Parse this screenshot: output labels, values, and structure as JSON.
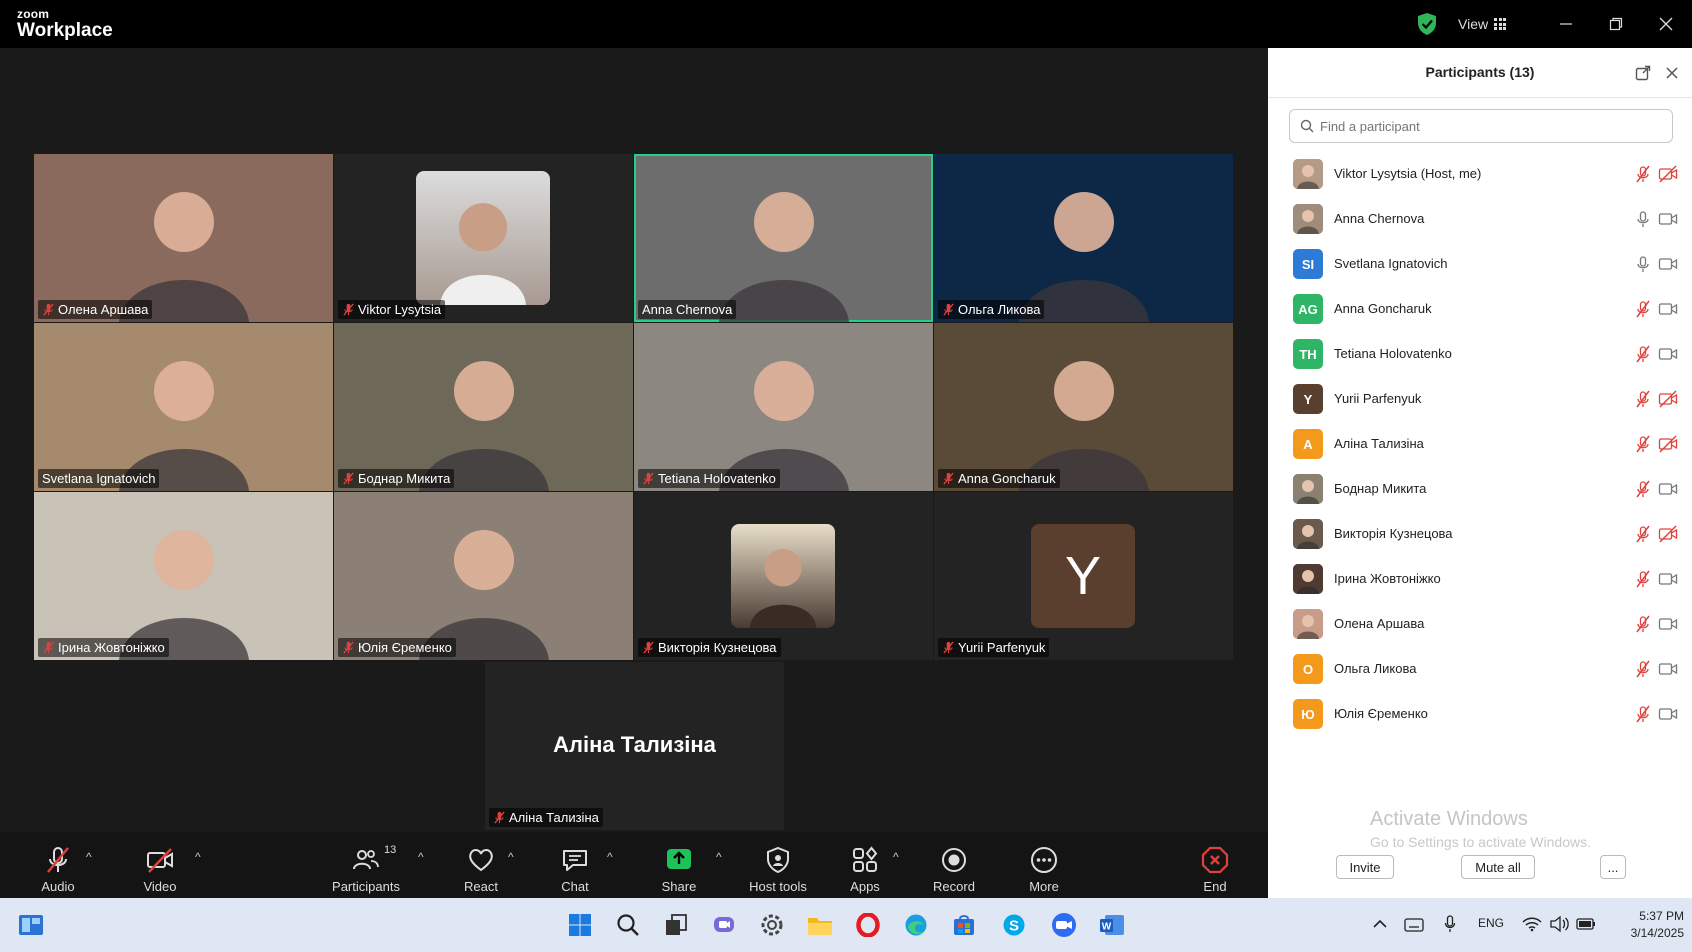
{
  "app": {
    "brand_small": "zoom",
    "brand_big": "Workplace",
    "view_label": "View"
  },
  "tiles": [
    {
      "name": "Олена Аршава",
      "muted": true,
      "bg": "#8a6a5c"
    },
    {
      "name": "Viktor Lysytsia",
      "muted": true,
      "bg": "#232323"
    },
    {
      "name": "Anna Chernova",
      "muted": false,
      "bg": "#6d6d6d",
      "active": true
    },
    {
      "name": "Ольга Ликова",
      "muted": true,
      "bg": "#0d2746"
    },
    {
      "name": "Svetlana Ignatovich",
      "muted": false,
      "bg": "#a58a6e"
    },
    {
      "name": "Боднар Микита",
      "muted": true,
      "bg": "#6e6858"
    },
    {
      "name": "Tetiana Holovatenko",
      "muted": true,
      "bg": "#8d8782"
    },
    {
      "name": "Anna Goncharuk",
      "muted": true,
      "bg": "#5a4a38"
    },
    {
      "name": "Ірина Жовтоніжко",
      "muted": true,
      "bg": "#c9c2b6"
    },
    {
      "name": "Юлія Єременко",
      "muted": true,
      "bg": "#8c8076"
    },
    {
      "name": "Викторія Кузнецова",
      "muted": true,
      "bg": "#232323"
    },
    {
      "name": "Yurii Parfenyuk",
      "muted": true,
      "bg": "#232323",
      "letter": "Y"
    }
  ],
  "spotlight_tile": {
    "display_name": "Аліна Тализіна",
    "label": "Аліна Тализіна"
  },
  "toolbar": {
    "audio": "Audio",
    "video": "Video",
    "participants": "Participants",
    "participants_count": "13",
    "react": "React",
    "chat": "Chat",
    "share": "Share",
    "host_tools": "Host tools",
    "apps": "Apps",
    "record": "Record",
    "more": "More",
    "end": "End"
  },
  "panel": {
    "title": "Participants (13)",
    "search_placeholder": "Find a participant",
    "participants": [
      {
        "name": "Viktor Lysytsia (Host, me)",
        "avatar": "photo",
        "color": "#b59a86",
        "mic": "muted",
        "cam": "off"
      },
      {
        "name": "Anna Chernova",
        "avatar": "photo",
        "color": "#a08c7a",
        "mic": "on",
        "cam": "on"
      },
      {
        "name": "Svetlana Ignatovich",
        "avatar": "SI",
        "color": "#2d7bd6",
        "mic": "on",
        "cam": "on"
      },
      {
        "name": "Anna Goncharuk",
        "avatar": "AG",
        "color": "#2fb566",
        "mic": "muted",
        "cam": "on"
      },
      {
        "name": "Tetiana Holovatenko",
        "avatar": "TH",
        "color": "#2fb566",
        "mic": "muted",
        "cam": "on"
      },
      {
        "name": "Yurii Parfenyuk",
        "avatar": "Y",
        "color": "#5a3e2e",
        "mic": "muted",
        "cam": "off"
      },
      {
        "name": "Аліна Тализіна",
        "avatar": "A",
        "color": "#f39a1d",
        "mic": "muted",
        "cam": "off"
      },
      {
        "name": "Боднар Микита",
        "avatar": "photo",
        "color": "#8b8170",
        "mic": "muted",
        "cam": "on"
      },
      {
        "name": "Викторія Кузнецова",
        "avatar": "photo",
        "color": "#6b5a4c",
        "mic": "muted",
        "cam": "off"
      },
      {
        "name": "Ірина Жовтоніжко",
        "avatar": "photo",
        "color": "#4f3b33",
        "mic": "muted",
        "cam": "on"
      },
      {
        "name": "Олена Аршава",
        "avatar": "photo",
        "color": "#c79c88",
        "mic": "muted",
        "cam": "on"
      },
      {
        "name": "Ольга Ликова",
        "avatar": "O",
        "color": "#f39a1d",
        "mic": "muted",
        "cam": "on"
      },
      {
        "name": "Юлія Єременко",
        "avatar": "Ю",
        "color": "#f39a1d",
        "mic": "muted",
        "cam": "on"
      }
    ],
    "watermark_title": "Activate Windows",
    "watermark_sub": "Go to Settings to activate Windows.",
    "invite": "Invite",
    "mute_all": "Mute all",
    "more": "..."
  },
  "taskbar": {
    "lang": "ENG",
    "time": "5:37 PM",
    "date": "3/14/2025"
  }
}
